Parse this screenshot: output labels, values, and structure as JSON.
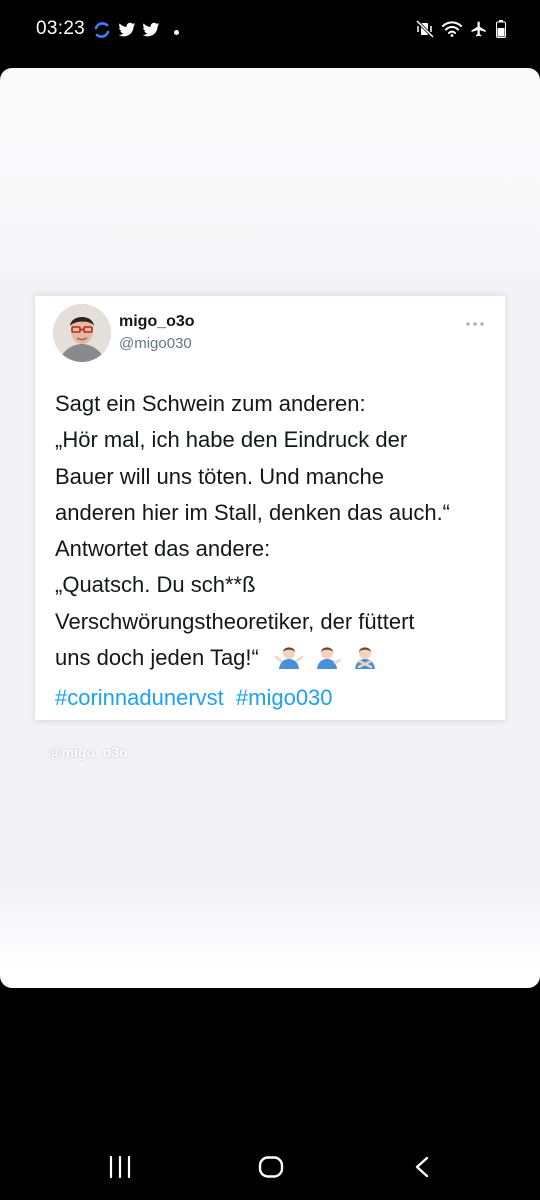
{
  "status_bar": {
    "time": "03:23",
    "left_icons": [
      "sync-app-icon",
      "twitter-bird-icon",
      "twitter-bird-icon",
      "notification-dot"
    ],
    "right_icons": [
      "vibrate-mute-icon",
      "wifi-icon",
      "airplane-icon",
      "battery-icon"
    ]
  },
  "tweet": {
    "name": "migo_o3o",
    "handle": "@migo030",
    "lines": [
      "Sagt ein Schwein zum anderen:",
      "„Hör mal, ich habe den Eindruck der",
      "Bauer will uns töten. Und manche",
      "anderen hier im Stall, denken das auch.“",
      "Antwortet das andere:",
      "„Quatsch. Du sch**ß",
      "Verschwörungstheoretiker, der füttert",
      "uns doch jeden Tag!“"
    ],
    "emojis": [
      "man-shrugging-emoji",
      "man-tipping-hand-emoji",
      "man-gesturing-no-emoji"
    ],
    "hashtags": [
      "#corinnadunervst",
      "#migo030"
    ]
  },
  "watermark": "@migo_o3o",
  "nav_bar": {
    "items": [
      "recent-apps-icon",
      "home-icon",
      "back-icon"
    ]
  },
  "colors": {
    "link": "#1da1f2",
    "text": "#14171a",
    "handle": "#657786"
  }
}
